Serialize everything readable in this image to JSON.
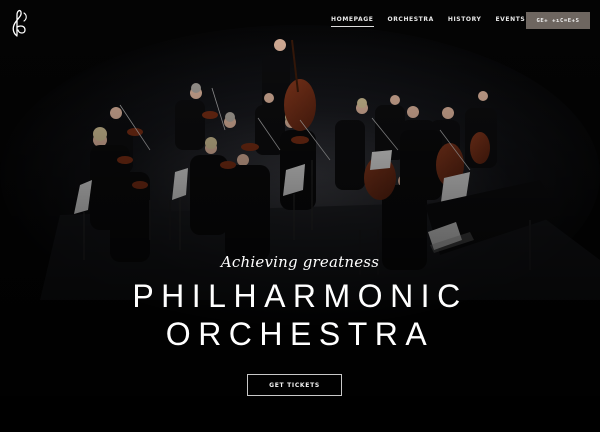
{
  "nav": {
    "items": [
      {
        "label": "HOMEPAGE",
        "active": true
      },
      {
        "label": "ORCHESTRA",
        "active": false
      },
      {
        "label": "HISTORY",
        "active": false
      },
      {
        "label": "EVENTS",
        "active": false
      }
    ],
    "button_label": "GE+ +ıC=E+S"
  },
  "hero": {
    "tagline": "Achieving greatness",
    "title_line1": "PHILHARMONIC",
    "title_line2": "ORCHESTRA",
    "cta_label": "GET TICKETS"
  },
  "colors": {
    "background": "#000000",
    "header_button": "#6e6660",
    "text": "#ffffff"
  },
  "icons": [
    "treble-clef-logo-icon"
  ]
}
